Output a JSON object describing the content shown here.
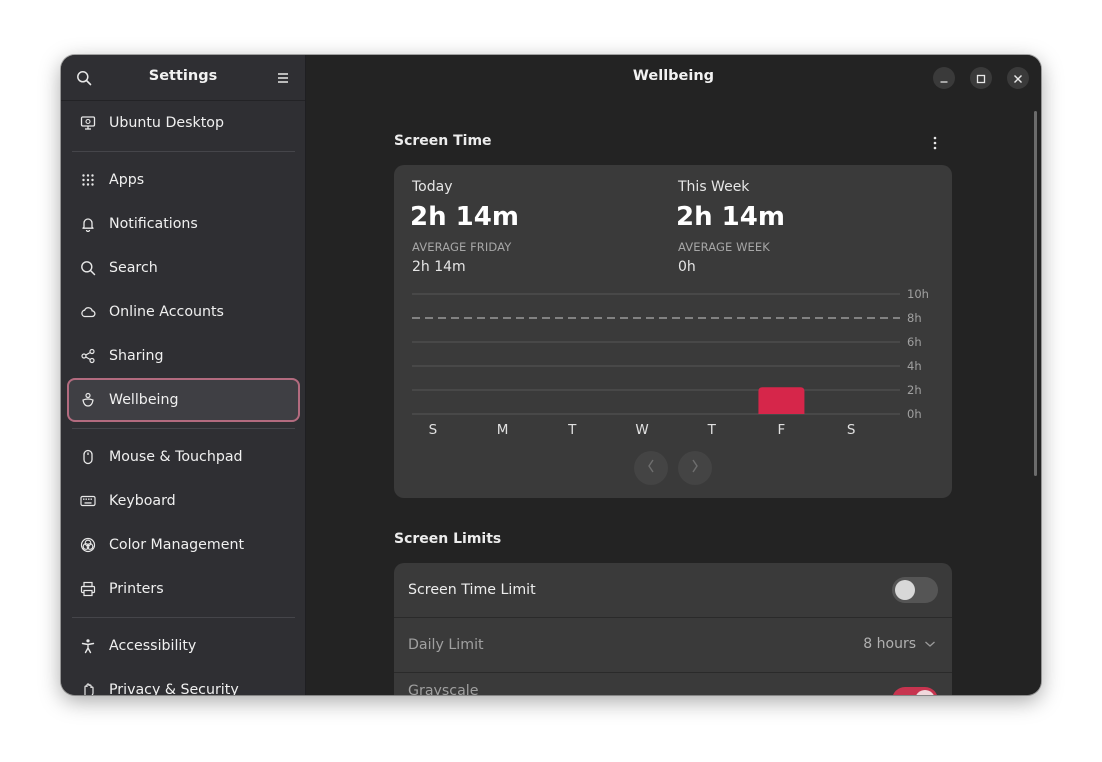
{
  "sidebar": {
    "title": "Settings",
    "items": [
      {
        "label": "Ubuntu Desktop",
        "icon": "desktop-icon"
      },
      {
        "label": "Apps",
        "icon": "apps-grid-icon"
      },
      {
        "label": "Notifications",
        "icon": "bell-icon"
      },
      {
        "label": "Search",
        "icon": "search-icon"
      },
      {
        "label": "Online Accounts",
        "icon": "cloud-icon"
      },
      {
        "label": "Sharing",
        "icon": "share-icon"
      },
      {
        "label": "Wellbeing",
        "icon": "wellbeing-icon",
        "active": true
      },
      {
        "label": "Mouse & Touchpad",
        "icon": "mouse-icon"
      },
      {
        "label": "Keyboard",
        "icon": "keyboard-icon"
      },
      {
        "label": "Color Management",
        "icon": "color-icon"
      },
      {
        "label": "Printers",
        "icon": "printer-icon"
      },
      {
        "label": "Accessibility",
        "icon": "accessibility-icon"
      },
      {
        "label": "Privacy & Security",
        "icon": "hand-icon"
      }
    ]
  },
  "header": {
    "title": "Wellbeing"
  },
  "screen_time": {
    "section_title": "Screen Time",
    "today_label": "Today",
    "today_value": "2h 14m",
    "today_avg_caption": "AVERAGE FRIDAY",
    "today_avg_value": "2h 14m",
    "week_label": "This Week",
    "week_value": "2h 14m",
    "week_avg_caption": "AVERAGE WEEK",
    "week_avg_value": "0h"
  },
  "chart_data": {
    "type": "bar",
    "categories": [
      "S",
      "M",
      "T",
      "W",
      "T",
      "F",
      "S"
    ],
    "values": [
      0,
      0,
      0,
      0,
      0,
      2.23,
      0
    ],
    "y_ticks": [
      "0h",
      "2h",
      "4h",
      "6h",
      "8h",
      "10h"
    ],
    "ylim": [
      0,
      10
    ],
    "limit_line": 8,
    "bar_color": "#d6264a"
  },
  "screen_limits": {
    "section_title": "Screen Limits",
    "screen_time_limit_label": "Screen Time Limit",
    "screen_time_limit_on": false,
    "daily_limit_label": "Daily Limit",
    "daily_limit_value": "8 hours",
    "grayscale_label": "Grayscale",
    "grayscale_on": true
  },
  "colors": {
    "accent": "#d6264a",
    "active_outline": "#b36b7f"
  }
}
